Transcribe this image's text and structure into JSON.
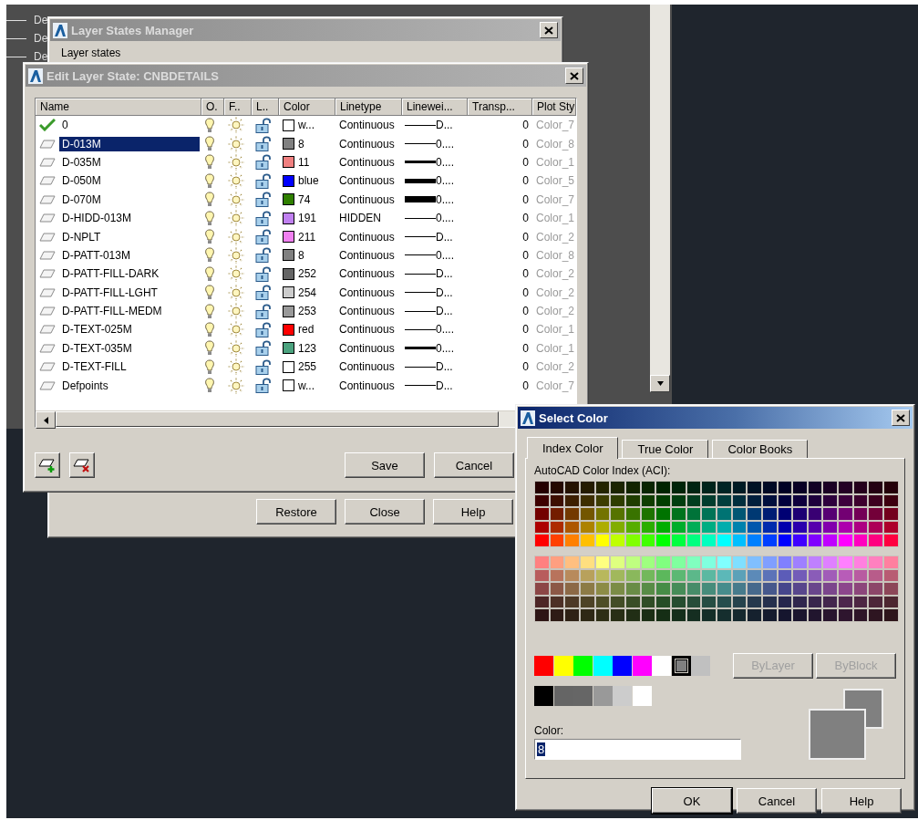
{
  "background": {
    "layer_names": [
      "De",
      "De",
      "De"
    ]
  },
  "layer_states_manager": {
    "title": "Layer States Manager",
    "active": false,
    "label": "Layer states",
    "buttons": [
      "Restore",
      "Close",
      "Help"
    ]
  },
  "edit_layer_state": {
    "title": "Edit Layer State: CNBDETAILS",
    "active": false,
    "columns": [
      "Name",
      "O.",
      "F..",
      "L..",
      "Color",
      "Linetype",
      "Linewei...",
      "Transp...",
      "Plot Sty"
    ],
    "rows": [
      {
        "name": "0",
        "current": true,
        "selected": false,
        "on": true,
        "frozen": false,
        "locked": false,
        "color": "#ffffff",
        "color_name": "w...",
        "linetype": "Continuous",
        "kind": "thin",
        "lineweight": "D...",
        "transparency": "0",
        "plot_style": "Color_7"
      },
      {
        "name": "D-013M",
        "current": false,
        "selected": true,
        "on": true,
        "frozen": false,
        "locked": false,
        "color": "#808080",
        "color_name": "8",
        "linetype": "Continuous",
        "kind": "thin",
        "lineweight": "0....",
        "transparency": "0",
        "plot_style": "Color_8"
      },
      {
        "name": "D-035M",
        "current": false,
        "selected": false,
        "on": true,
        "frozen": false,
        "locked": false,
        "color": "#f08080",
        "color_name": "11",
        "linetype": "Continuous",
        "kind": "medium",
        "lineweight": "0....",
        "transparency": "0",
        "plot_style": "Color_1"
      },
      {
        "name": "D-050M",
        "current": false,
        "selected": false,
        "on": true,
        "frozen": false,
        "locked": false,
        "color": "#0000ff",
        "color_name": "blue",
        "linetype": "Continuous",
        "kind": "thick",
        "lineweight": "0....",
        "transparency": "0",
        "plot_style": "Color_5"
      },
      {
        "name": "D-070M",
        "current": false,
        "selected": false,
        "on": true,
        "frozen": false,
        "locked": false,
        "color": "#2f7f00",
        "color_name": "74",
        "linetype": "Continuous",
        "kind": "heavy",
        "lineweight": "0....",
        "transparency": "0",
        "plot_style": "Color_7"
      },
      {
        "name": "D-HIDD-013M",
        "current": false,
        "selected": false,
        "on": true,
        "frozen": false,
        "locked": false,
        "color": "#c080f0",
        "color_name": "191",
        "linetype": "HIDDEN",
        "kind": "thin",
        "lineweight": "0....",
        "transparency": "0",
        "plot_style": "Color_1"
      },
      {
        "name": "D-NPLT",
        "current": false,
        "selected": false,
        "on": true,
        "frozen": false,
        "locked": false,
        "color": "#f080f0",
        "color_name": "211",
        "linetype": "Continuous",
        "kind": "thin",
        "lineweight": "D...",
        "transparency": "0",
        "plot_style": "Color_2"
      },
      {
        "name": "D-PATT-013M",
        "current": false,
        "selected": false,
        "on": true,
        "frozen": false,
        "locked": false,
        "color": "#808080",
        "color_name": "8",
        "linetype": "Continuous",
        "kind": "thin",
        "lineweight": "0....",
        "transparency": "0",
        "plot_style": "Color_8"
      },
      {
        "name": "D-PATT-FILL-DARK",
        "current": false,
        "selected": false,
        "on": true,
        "frozen": false,
        "locked": false,
        "color": "#656565",
        "color_name": "252",
        "linetype": "Continuous",
        "kind": "thin",
        "lineweight": "D...",
        "transparency": "0",
        "plot_style": "Color_2"
      },
      {
        "name": "D-PATT-FILL-LGHT",
        "current": false,
        "selected": false,
        "on": true,
        "frozen": false,
        "locked": false,
        "color": "#cccccc",
        "color_name": "254",
        "linetype": "Continuous",
        "kind": "thin",
        "lineweight": "D...",
        "transparency": "0",
        "plot_style": "Color_2"
      },
      {
        "name": "D-PATT-FILL-MEDM",
        "current": false,
        "selected": false,
        "on": true,
        "frozen": false,
        "locked": false,
        "color": "#999999",
        "color_name": "253",
        "linetype": "Continuous",
        "kind": "thin",
        "lineweight": "D...",
        "transparency": "0",
        "plot_style": "Color_2"
      },
      {
        "name": "D-TEXT-025M",
        "current": false,
        "selected": false,
        "on": true,
        "frozen": false,
        "locked": false,
        "color": "#ff0000",
        "color_name": "red",
        "linetype": "Continuous",
        "kind": "thin",
        "lineweight": "0....",
        "transparency": "0",
        "plot_style": "Color_1"
      },
      {
        "name": "D-TEXT-035M",
        "current": false,
        "selected": false,
        "on": true,
        "frozen": false,
        "locked": false,
        "color": "#4ca37f",
        "color_name": "123",
        "linetype": "Continuous",
        "kind": "medium",
        "lineweight": "0....",
        "transparency": "0",
        "plot_style": "Color_1"
      },
      {
        "name": "D-TEXT-FILL",
        "current": false,
        "selected": false,
        "on": true,
        "frozen": false,
        "locked": false,
        "color": "#ffffff",
        "color_name": "255",
        "linetype": "Continuous",
        "kind": "thin",
        "lineweight": "D...",
        "transparency": "0",
        "plot_style": "Color_2"
      },
      {
        "name": "Defpoints",
        "current": false,
        "selected": false,
        "on": true,
        "frozen": false,
        "locked": false,
        "color": "#ffffff",
        "color_name": "w...",
        "linetype": "Continuous",
        "kind": "thin",
        "lineweight": "D...",
        "transparency": "0",
        "plot_style": "Color_7"
      }
    ],
    "buttons": [
      "Save",
      "Cancel"
    ]
  },
  "select_color": {
    "title": "Select Color",
    "active": true,
    "tabs": [
      {
        "label": "Index Color",
        "selected": true
      },
      {
        "label": "True Color",
        "selected": false
      },
      {
        "label": "Color Books",
        "selected": false
      }
    ],
    "palette_label": "AutoCAD Color Index (ACI):",
    "standard_colors": [
      {
        "color": "#ff0000",
        "selected": false
      },
      {
        "color": "#ffff00",
        "selected": false
      },
      {
        "color": "#00ff00",
        "selected": false
      },
      {
        "color": "#00ffff",
        "selected": false
      },
      {
        "color": "#0000ff",
        "selected": false
      },
      {
        "color": "#ff00ff",
        "selected": false
      },
      {
        "color": "#ffffff",
        "selected": false
      },
      {
        "color": "#808080",
        "selected": true
      },
      {
        "color": "#c0c0c0",
        "selected": false
      }
    ],
    "gray_colors": [
      {
        "color": "#000000",
        "selected": false
      },
      {
        "color": "#656565",
        "selected": false
      },
      {
        "color": "#666666",
        "selected": false
      },
      {
        "color": "#999999",
        "selected": false
      },
      {
        "color": "#cccccc",
        "selected": false
      },
      {
        "color": "#ffffff",
        "selected": false
      }
    ],
    "by_buttons": [
      {
        "label": "ByLayer",
        "disabled": true
      },
      {
        "label": "ByBlock",
        "disabled": true
      }
    ],
    "color_label": "Color:",
    "color_value": "8",
    "preview": [
      {
        "kind": "old",
        "color": "#808080"
      },
      {
        "kind": "new",
        "color": "#808080"
      }
    ],
    "buttons": [
      {
        "label": "OK",
        "default": true
      },
      {
        "label": "Cancel",
        "default": false
      },
      {
        "label": "Help",
        "default": false
      }
    ]
  }
}
